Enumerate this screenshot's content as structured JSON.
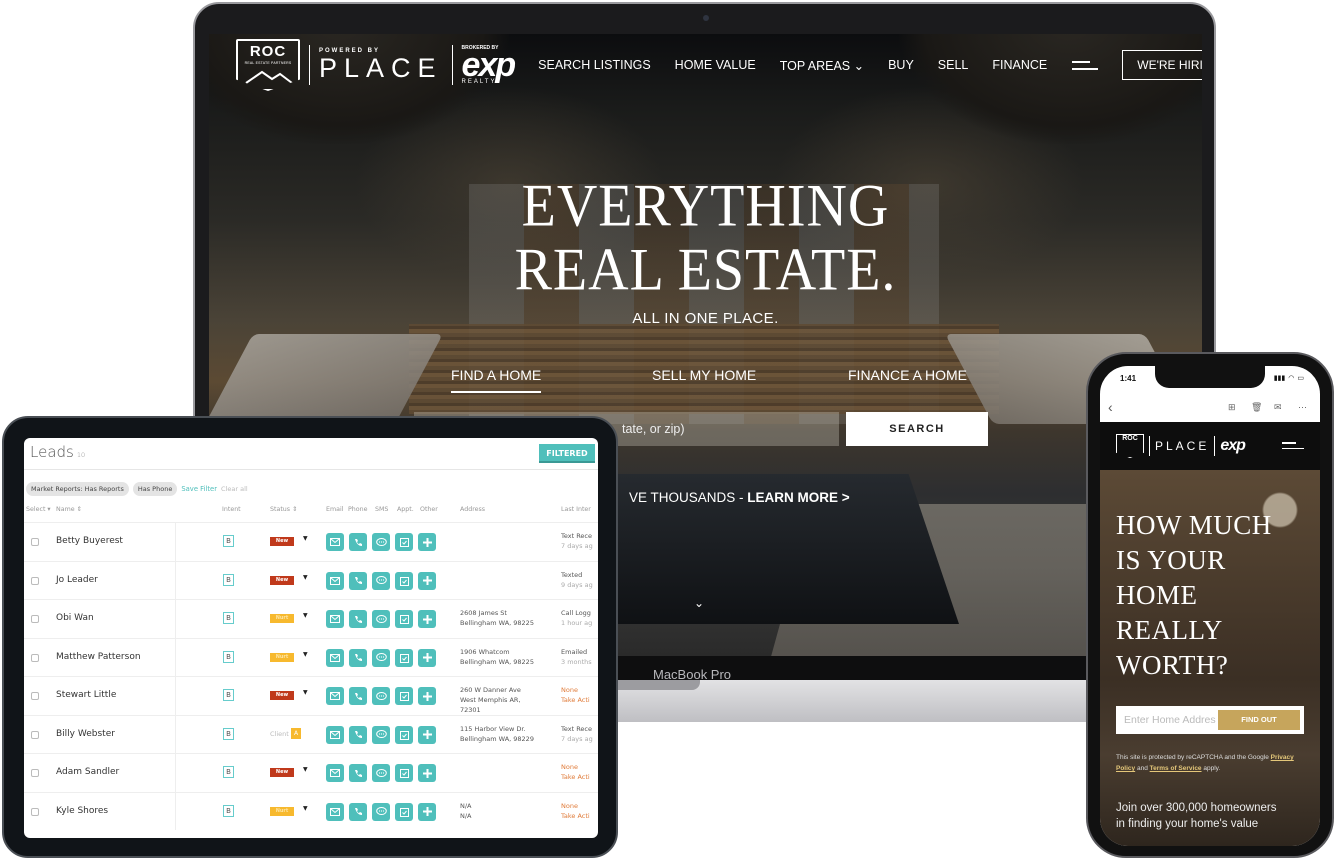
{
  "laptop": {
    "logo": {
      "roc": "ROC",
      "roc_sub": "REAL ESTATE PARTNERS",
      "powered_by": "POWERED BY",
      "place": "PLACE",
      "brokered_by": "BROKERED BY",
      "exp": "exp",
      "realty": "REALTY"
    },
    "nav": [
      "SEARCH LISTINGS",
      "HOME VALUE",
      "TOP AREAS ⌄",
      "BUY",
      "SELL",
      "FINANCE"
    ],
    "hiring_button": "WE'RE HIRING",
    "hero": {
      "line1": "EVERYTHING",
      "line2": "REAL ESTATE.",
      "subtitle": "ALL IN ONE PLACE."
    },
    "tabs": [
      {
        "label": "FIND A HOME",
        "active": true
      },
      {
        "label": "SELL MY HOME",
        "active": false
      },
      {
        "label": "FINANCE A HOME",
        "active": false
      }
    ],
    "search_placeholder_visible": "tate, or zip)",
    "search_button": "SEARCH",
    "promo": {
      "text": "VE THOUSANDS - ",
      "link": "LEARN MORE >"
    },
    "scroll_icon": "⌄",
    "model_label": "MacBook Pro"
  },
  "tablet": {
    "title": "Leads",
    "count": "10",
    "filtered_button": "FILTERED",
    "chips": [
      "Market Reports: Has Reports",
      "Has Phone"
    ],
    "save_filter": "Save Filter",
    "clear_all": "Clear all",
    "columns": {
      "select": "Select ▾",
      "name": "Name ⇕",
      "intent": "Intent",
      "status": "Status ⇕",
      "email": "Email",
      "phone": "Phone",
      "sms": "SMS",
      "appt": "Appt.",
      "other": "Other",
      "address": "Address",
      "last": "Last Inter"
    },
    "rows": [
      {
        "name": "Betty Buyerest",
        "intent": "B",
        "status": "New",
        "status_type": "new",
        "address1": "",
        "address2": "",
        "address3": "",
        "last1": "Text Rece",
        "last2": "7 days ag",
        "warn": false
      },
      {
        "name": "Jo Leader",
        "intent": "B",
        "status": "New",
        "status_type": "new",
        "address1": "",
        "address2": "",
        "address3": "",
        "last1": "Texted",
        "last2": "9 days ag",
        "warn": false
      },
      {
        "name": "Obi Wan",
        "intent": "B",
        "status": "Nurt",
        "status_type": "nurt",
        "address1": "2608 James St",
        "address2": "Bellingham WA, 98225",
        "address3": "",
        "last1": "Call Logg",
        "last2": "1 hour ag",
        "warn": false
      },
      {
        "name": "Matthew Patterson",
        "intent": "B",
        "status": "Nurt",
        "status_type": "nurt",
        "address1": "1906 Whatcom",
        "address2": "Bellingham WA, 98225",
        "address3": "",
        "last1": "Emailed",
        "last2": "3 months",
        "warn": false
      },
      {
        "name": "Stewart Little",
        "intent": "B",
        "status": "New",
        "status_type": "new",
        "address1": "260 W Danner Ave",
        "address2": "West Memphis AR,",
        "address3": "72301",
        "last1": "None",
        "last2": "Take Acti",
        "warn": true
      },
      {
        "name": "Billy Webster",
        "intent": "B",
        "status": "Client",
        "status_type": "client",
        "client_badge": "A",
        "address1": "115 Harbor View Dr.",
        "address2": "Bellingham WA, 98229",
        "address3": "",
        "last1": "Text Rece",
        "last2": "7 days ag",
        "warn": false
      },
      {
        "name": "Adam Sandler",
        "intent": "B",
        "status": "New",
        "status_type": "new",
        "address1": "",
        "address2": "",
        "address3": "",
        "last1": "None",
        "last2": "Take Acti",
        "warn": true
      },
      {
        "name": "Kyle Shores",
        "intent": "B",
        "status": "Nurt",
        "status_type": "nurt",
        "address1": "N/A",
        "address2": "N/A",
        "address3": "",
        "last1": "None",
        "last2": "Take Acti",
        "warn": true
      }
    ]
  },
  "phone": {
    "time": "1:41",
    "hero_lines": [
      "HOW MUCH",
      "IS YOUR",
      "HOME",
      "REALLY",
      "WORTH?"
    ],
    "input_placeholder": "Enter Home Address",
    "find_out_button": "FIND OUT",
    "recaptcha_text": "This site is protected by reCAPTCHA and the Google",
    "privacy_link": "Privacy Policy",
    "and": "and",
    "terms_link": "Terms of Service",
    "apply": "apply.",
    "join_line1": "Join over 300,000 homeowners",
    "join_line2": "in finding your home's value",
    "logo": {
      "roc": "ROC",
      "place": "PLACE",
      "exp": "exp"
    }
  },
  "colors": {
    "teal": "#4fbfbb",
    "new_red": "#c0391b",
    "nurt_yellow": "#f7b92e",
    "gold": "#c6a55c",
    "warn_orange": "#e07b39"
  }
}
